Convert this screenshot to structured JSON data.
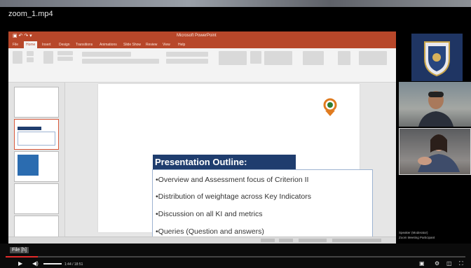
{
  "video": {
    "file_title": "zoom_1.mp4",
    "sub_label": "File [h]",
    "time_display": "1:44 / 18:51",
    "progress_fraction": 0.07
  },
  "ppt": {
    "quick_access": "File",
    "doc_title": "Microsoft PowerPoint",
    "tabs": [
      "File",
      "Home",
      "Insert",
      "Design",
      "Transitions",
      "Animations",
      "Slide Show",
      "Review",
      "View",
      "Help"
    ],
    "active_tab": "Home"
  },
  "slide": {
    "title": "Presentation Outline:",
    "bullets": [
      "•Overview and Assessment focus of Criterion II",
      "•Distribution of weightage across Key Indicators",
      "•Discussion on all KI and metrics",
      "•Queries (Question and answers)"
    ]
  },
  "participants": {
    "woman_caption": "Speaker (Moderator)",
    "woman_sub": "Zoom Meeting Participant"
  },
  "colors": {
    "ppt_accent": "#b7472a",
    "title_box": "#1f3d6e",
    "progress": "#e32b2b"
  }
}
